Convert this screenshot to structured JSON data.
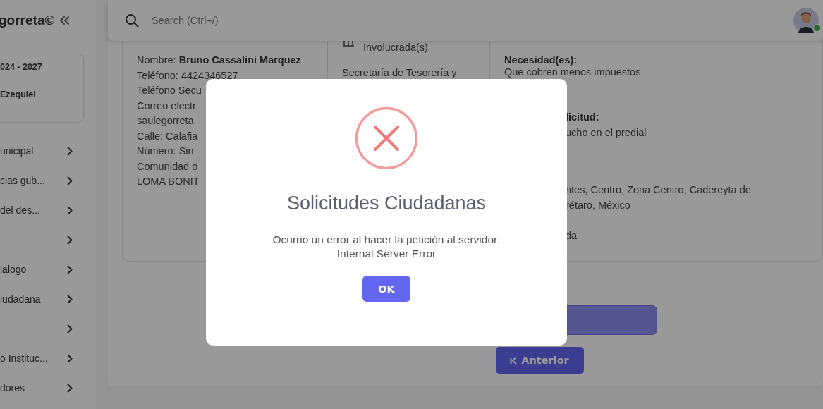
{
  "sidebar": {
    "brand": "gorreta©",
    "period": "024 - 2027",
    "user": "Ezequiel",
    "items": [
      {
        "kind": "labeled",
        "label": "unicipal"
      },
      {
        "kind": "labeled",
        "label": "cias gub..."
      },
      {
        "kind": "labeled",
        "label": "del des..."
      },
      {
        "kind": "icon_only"
      },
      {
        "kind": "labeled",
        "label": "ialogo"
      },
      {
        "kind": "labeled",
        "label": "iudadana"
      },
      {
        "kind": "icon_only"
      },
      {
        "kind": "labeled",
        "label": "o Instituc..."
      },
      {
        "kind": "labeled",
        "label": "dores"
      }
    ]
  },
  "header": {
    "search": {
      "placeholder": "Search (Ctrl+/)"
    },
    "user": {
      "online": true
    }
  },
  "details": {
    "citizen": [
      "Nombre: **Bruno Cassalini Marquez**",
      "Teléfono: 4424346527",
      "Teléfono Secu",
      "Correo electr",
      "saulegorreta",
      "Calle: Calafia",
      "Número: Sin",
      "Comunidad o",
      "LOMA BONIT"
    ],
    "agency": {
      "heading": "Involucrada(s)",
      "lines": [
        "Secretaría de Tesorería y"
      ]
    },
    "request": {
      "need_heading": "Necesidad(es):",
      "need": "Que cobren menos impuestos",
      "request_heading": "licitud:",
      "request": "ucho en el predial",
      "address": [
        "ntes, Centro, Zona Centro, Cadereyta de",
        "rétaro, México"
      ],
      "status": "da"
    }
  },
  "nav": {
    "previous": "Anterior"
  },
  "dialog": {
    "title": "Solicitudes Ciudadanas",
    "message": [
      "Ocurrio un error al hacer la petición al servidor:",
      "Internal Server Error"
    ],
    "button": "OK"
  }
}
